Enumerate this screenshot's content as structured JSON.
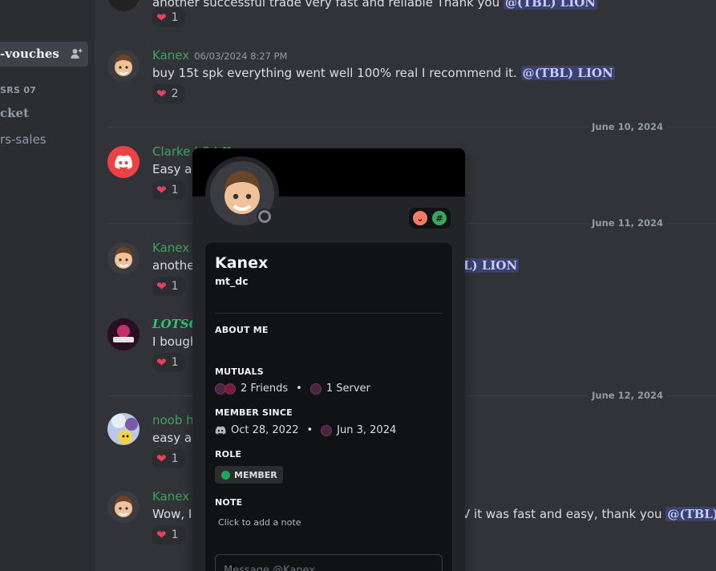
{
  "sidebar": {
    "active_channel": "-vouches",
    "category": "SRS 07",
    "channels": [
      "cket",
      "rs-sales"
    ]
  },
  "messages": [
    {
      "id": "m0",
      "text": "another successful trade very fast and reliable Thank you",
      "mention": "@(TBL) LION",
      "reaction": "1"
    },
    {
      "id": "m1",
      "user": "Kanex",
      "timestamp": "06/03/2024 8:27 PM",
      "text": "buy 15t spk everything went well 100% real I recommend it.",
      "mention": "@(TBL) LION",
      "reaction": "2"
    },
    {
      "id": "m2",
      "user": "Clarke | S | ♥",
      "text": "Easy an",
      "reaction": "1"
    },
    {
      "id": "m3",
      "user": "Kanex",
      "text": "another",
      "mention": "L) LION",
      "reaction": "1"
    },
    {
      "id": "m4",
      "user": "LOTSO",
      "text": "I bough",
      "reaction": "1"
    },
    {
      "id": "m5",
      "user": "noob ha",
      "text": "easy an",
      "reaction": "1"
    },
    {
      "id": "m6",
      "user": "Kanex",
      "text": "Wow, I l",
      "text_tail": "V it was fast and easy, thank you",
      "mention": "@(TBL) LIO",
      "reaction": "1"
    }
  ],
  "dividers": [
    "June 10, 2024",
    "June 11, 2024",
    "June 12, 2024"
  ],
  "profile": {
    "display_name": "Kanex",
    "username": "mt_dc",
    "about_label": "ABOUT ME",
    "mutuals_label": "MUTUALS",
    "mutual_friends": "2 Friends",
    "mutual_servers": "1 Server",
    "member_since_label": "MEMBER SINCE",
    "discord_since": "Oct 28, 2022",
    "server_since": "Jun 3, 2024",
    "role_label": "ROLE",
    "role_name": "MEMBER",
    "note_label": "NOTE",
    "note_placeholder": "Click to add a note",
    "message_placeholder": "Message @Kanex"
  },
  "colors": {
    "kanex": "#3ba55c",
    "lotso": "#2dc770",
    "noob": "#3ba55c",
    "clarke": "#3ba55c",
    "role_dot": "#23a55a"
  }
}
